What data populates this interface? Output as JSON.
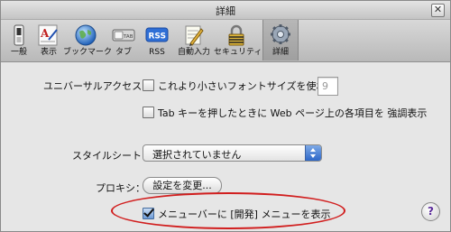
{
  "window": {
    "title": "詳細",
    "close_glyph": "✕"
  },
  "toolbar": {
    "items": [
      {
        "label": "一般",
        "icon": "general-switch-icon"
      },
      {
        "label": "表示",
        "icon": "appearance-font-icon"
      },
      {
        "label": "ブックマーク",
        "icon": "bookmarks-globe-icon"
      },
      {
        "label": "タブ",
        "icon": "tabs-icon"
      },
      {
        "label": "RSS",
        "icon": "rss-icon"
      },
      {
        "label": "自動入力",
        "icon": "autofill-pencil-icon"
      },
      {
        "label": "セキュリティ",
        "icon": "security-lock-icon"
      },
      {
        "label": "詳細",
        "icon": "advanced-gear-icon",
        "selected": true
      }
    ],
    "tab_icon_text": "TAB",
    "rss_icon_text": "RSS"
  },
  "accessibility": {
    "label": "ユニバーサルアクセス：",
    "min_font_label": "これより小さいフォントサイズを使わな",
    "min_font_checked": false,
    "min_font_value": "9",
    "tab_highlight_label": "Tab キーを押したときに Web ページ上の各項目を 強調表示",
    "tab_highlight_checked": false
  },
  "stylesheet": {
    "label": "スタイルシート：",
    "selected": "選択されていません"
  },
  "proxy": {
    "label": "プロキシ：",
    "button": "設定を変更..."
  },
  "develop_menu": {
    "label": "メニューバーに [開発] メニューを表示",
    "checked": true
  },
  "help": {
    "glyph": "?"
  },
  "colors": {
    "highlight": "#d11e1e",
    "popup_accent": "#2d67c8"
  }
}
